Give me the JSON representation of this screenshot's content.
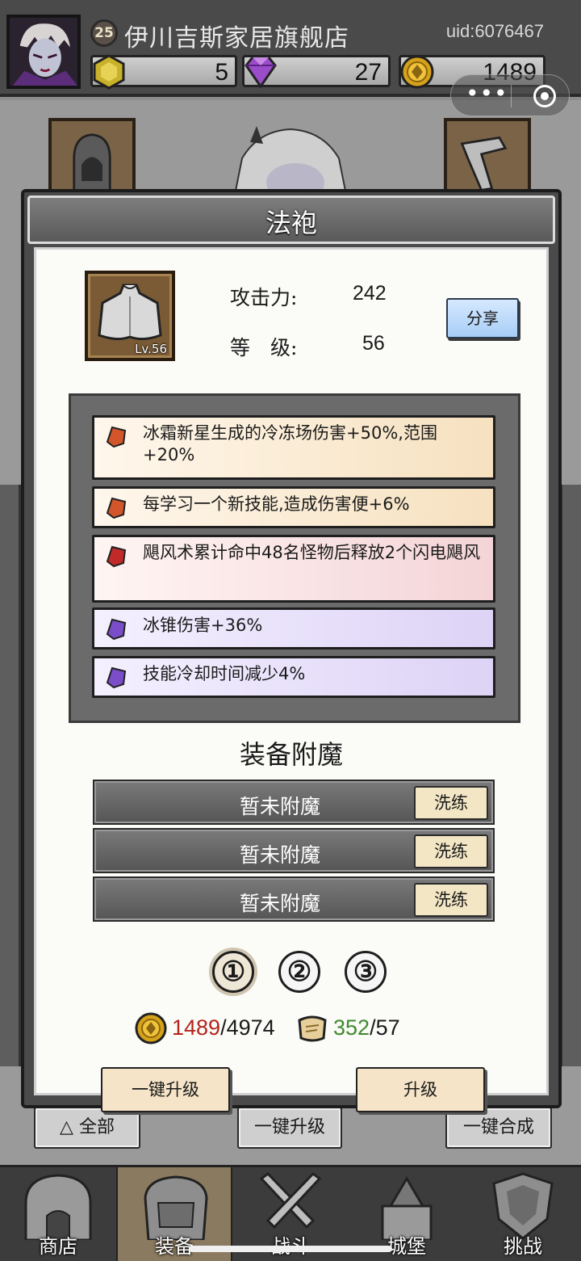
{
  "header": {
    "player_level": "25",
    "shop_name": "伊川吉斯家居旗舰店",
    "uid": "uid:6076467",
    "resources": [
      {
        "icon": "yellow-gem-icon",
        "value": "5"
      },
      {
        "icon": "purple-diamond-icon",
        "value": "27"
      },
      {
        "icon": "gold-coin-icon",
        "value": "1489"
      }
    ]
  },
  "modal": {
    "title": "法袍",
    "item": {
      "level": "Lv.56",
      "stats": [
        {
          "label": "攻击力:",
          "value": "242"
        },
        {
          "label": "等　级:",
          "value": "56"
        }
      ],
      "share_label": "分享"
    },
    "affixes": [
      {
        "text": "冰霜新星生成的冷冻场伤害+50%,范围+20%",
        "rarity": "orange",
        "gem_color": "#d2562a"
      },
      {
        "text": "每学习一个新技能,造成伤害便+6%",
        "rarity": "orange",
        "gem_color": "#d2562a"
      },
      {
        "text": "飓风术累计命中48名怪物后释放2个闪电飓风",
        "rarity": "red",
        "gem_color": "#c22a2a"
      },
      {
        "text": "冰锥伤害+36%",
        "rarity": "purple",
        "gem_color": "#7a4ec8"
      },
      {
        "text": "技能冷却时间减少4%",
        "rarity": "purple",
        "gem_color": "#7a4ec8"
      }
    ],
    "enchant": {
      "title": "装备附魔",
      "slots": [
        {
          "text": "暂未附魔",
          "button": "洗练"
        },
        {
          "text": "暂未附魔",
          "button": "洗练"
        },
        {
          "text": "暂未附魔",
          "button": "洗练"
        }
      ],
      "tabs": [
        "①",
        "②",
        "③"
      ],
      "active_tab": 0
    },
    "costs": {
      "gold": {
        "have": "1489",
        "need": "/4974"
      },
      "scroll": {
        "have": "352",
        "need": "/57"
      }
    },
    "buttons": {
      "upgrade_all": "一键升级",
      "upgrade": "升级"
    }
  },
  "bottom_buttons": {
    "all": "全部",
    "upgrade_all": "一键升级",
    "merge_all": "一键合成"
  },
  "nav": [
    {
      "label": "商店",
      "icon": "shop-icon"
    },
    {
      "label": "装备",
      "icon": "backpack-icon",
      "active": true
    },
    {
      "label": "战斗",
      "icon": "crossed-swords-icon"
    },
    {
      "label": "城堡",
      "icon": "castle-icon"
    },
    {
      "label": "挑战",
      "icon": "shield-icon"
    }
  ],
  "colors": {
    "header_bg": "#4a4a4a",
    "red_have": "#b3241c",
    "green_have": "#3f8a2c",
    "share_button": "#a8cdf6"
  }
}
